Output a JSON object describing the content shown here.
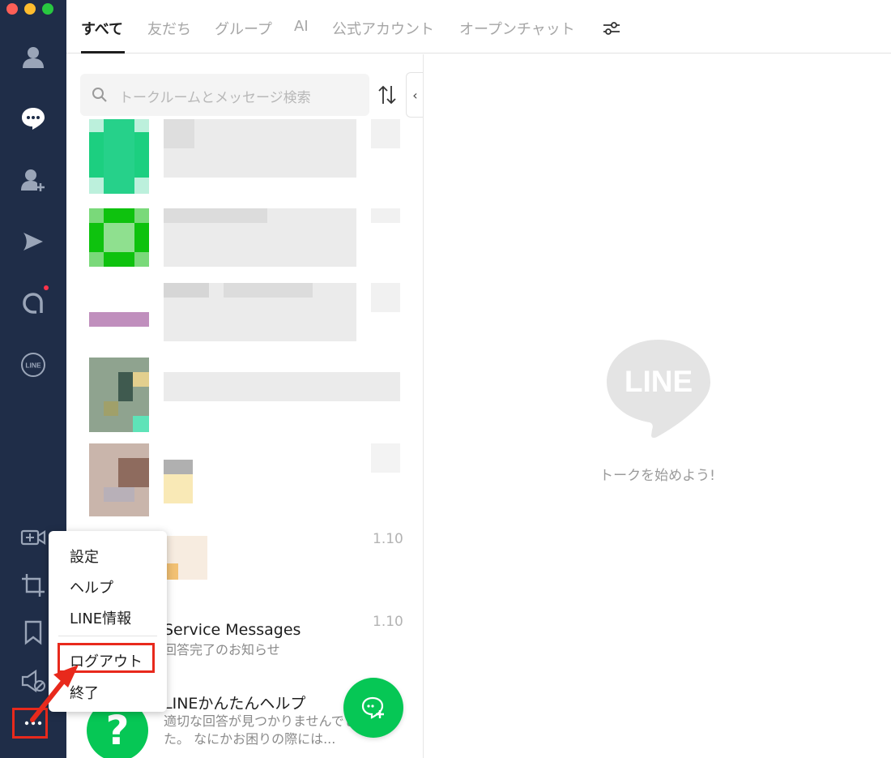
{
  "window": {
    "controls": [
      "close",
      "minimize",
      "zoom"
    ]
  },
  "sidebar": {
    "items": [
      {
        "name": "friends-icon",
        "label": ""
      },
      {
        "name": "chats-icon",
        "label": ""
      },
      {
        "name": "add-friend-icon",
        "label": ""
      },
      {
        "name": "voom-icon",
        "label": ""
      },
      {
        "name": "ai-icon",
        "label": "",
        "badge": true
      },
      {
        "name": "line-official-icon",
        "label": "LINE"
      },
      {
        "name": "video-call-icon",
        "label": ""
      },
      {
        "name": "screenshot-icon",
        "label": ""
      },
      {
        "name": "keep-icon",
        "label": ""
      },
      {
        "name": "mute-icon",
        "label": ""
      },
      {
        "name": "more-icon",
        "label": ""
      }
    ]
  },
  "tabs": [
    {
      "label": "すべて",
      "active": true
    },
    {
      "label": "友だち",
      "active": false
    },
    {
      "label": "グループ",
      "active": false
    },
    {
      "label": "AI",
      "active": false
    },
    {
      "label": "公式アカウント",
      "active": false
    },
    {
      "label": "オープンチャット",
      "active": false
    }
  ],
  "search": {
    "placeholder": "トークルームとメッセージ検索"
  },
  "chats": [
    {
      "name": "",
      "time": "1.10",
      "blurred": true
    },
    {
      "name": "",
      "time": "1.10",
      "blurred": true
    },
    {
      "name": "Service Messages",
      "preview": "回答完了のお知らせ",
      "time": ""
    },
    {
      "name": "LINEかんたんヘルプ",
      "preview": "適切な回答が見つかりませんでした。 なにかお困りの際には...",
      "time": "",
      "avatar_glyph": "?"
    }
  ],
  "empty_state": {
    "logo_text": "LINE",
    "message": "トークを始めよう!"
  },
  "menu": {
    "items": [
      "設定",
      "ヘルプ",
      "LINE情報",
      "ログアウト",
      "終了"
    ],
    "highlighted": "ログアウト"
  },
  "colors": {
    "sidebar": "#1f2d48",
    "accent": "#06c755",
    "annotation": "#e8291c"
  }
}
